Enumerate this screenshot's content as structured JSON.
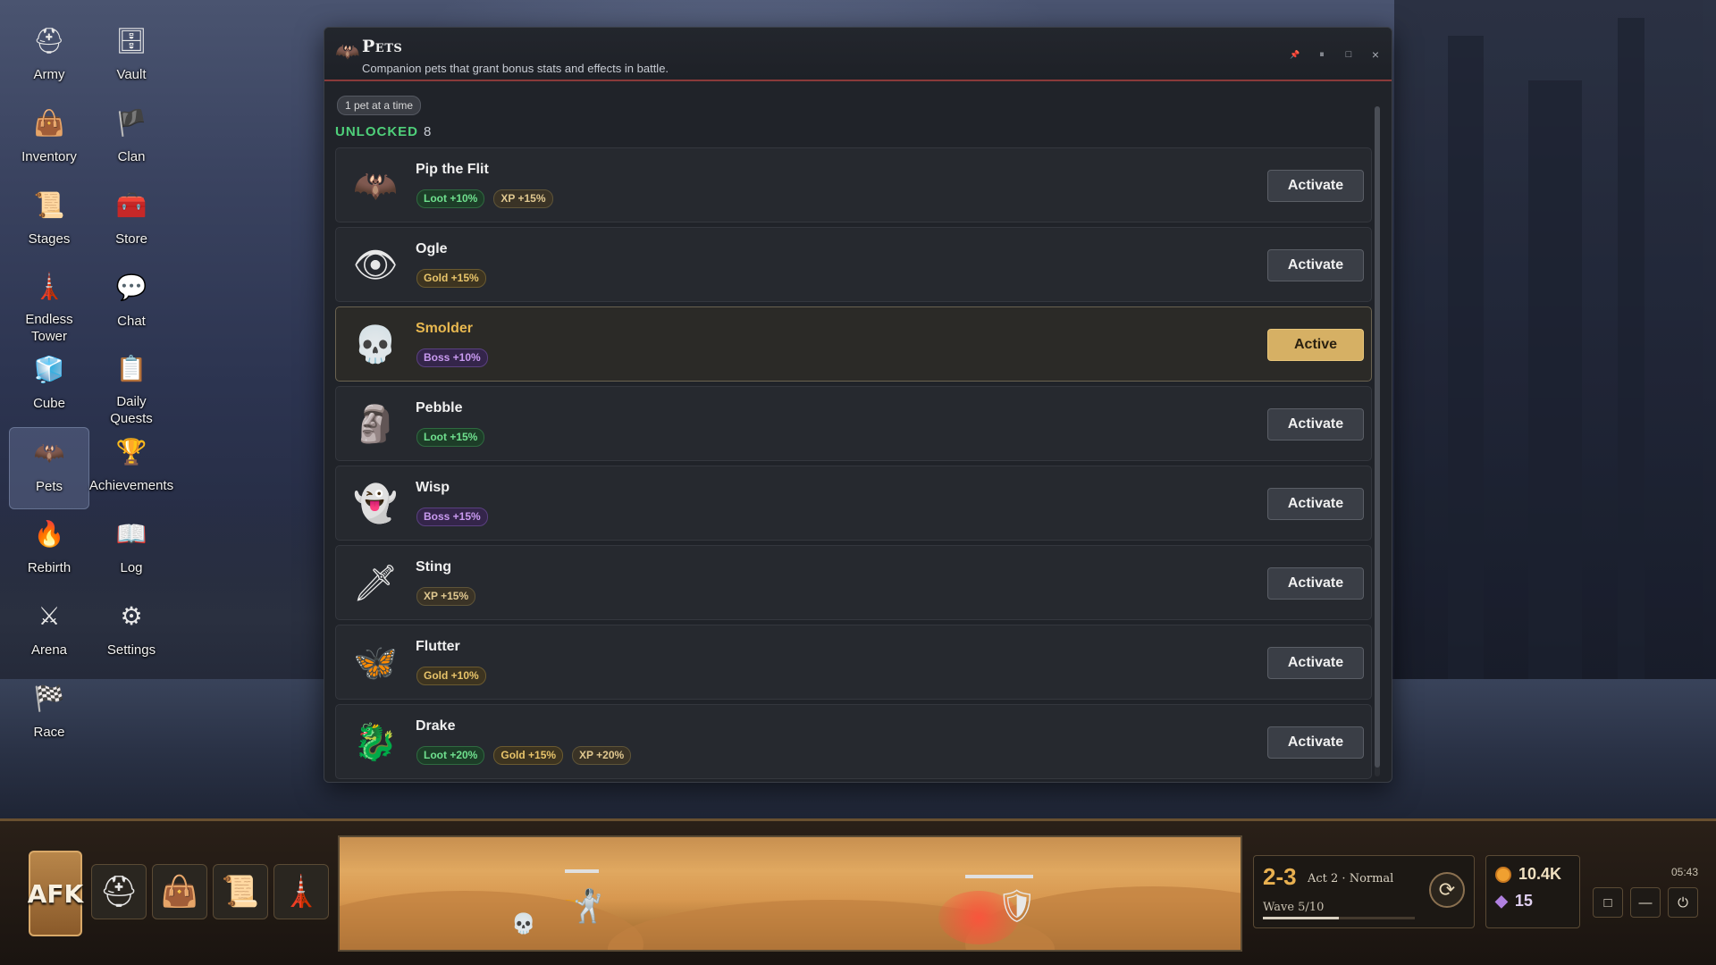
{
  "desktop": {
    "icons": [
      {
        "label": "Army",
        "icon": "knight-helmet-icon",
        "glyph": "⛑"
      },
      {
        "label": "Vault",
        "icon": "vault-chest-icon",
        "glyph": "🗄"
      },
      {
        "label": "Inventory",
        "icon": "bag-icon",
        "glyph": "👜"
      },
      {
        "label": "Clan",
        "icon": "clan-banner-icon",
        "glyph": "🏴"
      },
      {
        "label": "Stages",
        "icon": "scroll-map-icon",
        "glyph": "📜"
      },
      {
        "label": "Store",
        "icon": "treasure-chest-icon",
        "glyph": "🧰"
      },
      {
        "label": "Endless Tower",
        "icon": "tower-icon",
        "glyph": "🗼"
      },
      {
        "label": "Chat",
        "icon": "chat-bubbles-icon",
        "glyph": "💬"
      },
      {
        "label": "Cube",
        "icon": "cube-icon",
        "glyph": "🧊"
      },
      {
        "label": "Daily Quests",
        "icon": "quest-scroll-icon",
        "glyph": "📋"
      },
      {
        "label": "Pets",
        "icon": "pet-bat-icon",
        "glyph": "🦇",
        "selected": true
      },
      {
        "label": "Achievements",
        "icon": "trophy-shield-icon",
        "glyph": "🏆"
      },
      {
        "label": "Rebirth",
        "icon": "phoenix-icon",
        "glyph": "🔥"
      },
      {
        "label": "Log",
        "icon": "open-book-icon",
        "glyph": "📖"
      },
      {
        "label": "Arena",
        "icon": "crossed-swords-icon",
        "glyph": "⚔"
      },
      {
        "label": "Settings",
        "icon": "gear-icon",
        "glyph": "⚙"
      },
      {
        "label": "Race",
        "icon": "checkered-flag-icon",
        "glyph": "🏁"
      }
    ]
  },
  "window": {
    "title": "Pets",
    "subtitle": "Companion pets that grant bonus stats and effects in battle.",
    "limit_pill": "1 pet at a time",
    "unlocked_label": "UNLOCKED",
    "unlocked_count": "8",
    "controls": {
      "pin": "📌",
      "split": "⏸",
      "maximize": "□",
      "close": "×"
    }
  },
  "pets": [
    {
      "name": "Pip the Flit",
      "icon": "bat-pet-icon",
      "glyph": "🦇",
      "tags": [
        {
          "text": "Loot +10%",
          "kind": "loot"
        },
        {
          "text": "XP +15%",
          "kind": "xp"
        }
      ],
      "button": "Activate",
      "active": false
    },
    {
      "name": "Ogle",
      "icon": "eyeball-pet-icon",
      "glyph": "👁",
      "tags": [
        {
          "text": "Gold +15%",
          "kind": "gold"
        }
      ],
      "button": "Activate",
      "active": false
    },
    {
      "name": "Smolder",
      "icon": "flaming-skull-pet-icon",
      "glyph": "💀",
      "tags": [
        {
          "text": "Boss +10%",
          "kind": "boss"
        }
      ],
      "button": "Active",
      "active": true
    },
    {
      "name": "Pebble",
      "icon": "rock-golem-pet-icon",
      "glyph": "🗿",
      "tags": [
        {
          "text": "Loot +15%",
          "kind": "loot"
        }
      ],
      "button": "Activate",
      "active": false
    },
    {
      "name": "Wisp",
      "icon": "ghost-pet-icon",
      "glyph": "👻",
      "tags": [
        {
          "text": "Boss +15%",
          "kind": "boss"
        }
      ],
      "button": "Activate",
      "active": false
    },
    {
      "name": "Sting",
      "icon": "sword-pet-icon",
      "glyph": "🗡",
      "tags": [
        {
          "text": "XP +15%",
          "kind": "xp"
        }
      ],
      "button": "Activate",
      "active": false
    },
    {
      "name": "Flutter",
      "icon": "butterfly-pet-icon",
      "glyph": "🦋",
      "tags": [
        {
          "text": "Gold +10%",
          "kind": "gold"
        }
      ],
      "button": "Activate",
      "active": false
    },
    {
      "name": "Drake",
      "icon": "dragon-pet-icon",
      "glyph": "🐉",
      "tags": [
        {
          "text": "Loot +20%",
          "kind": "loot"
        },
        {
          "text": "Gold +15%",
          "kind": "gold"
        },
        {
          "text": "XP +20%",
          "kind": "xp"
        }
      ],
      "button": "Activate",
      "active": false
    }
  ],
  "taskbar": {
    "afk_label": "AFK",
    "quick": [
      {
        "icon": "knight-helmet-icon",
        "glyph": "⛑"
      },
      {
        "icon": "bag-icon",
        "glyph": "👜"
      },
      {
        "icon": "scroll-map-icon",
        "glyph": "📜"
      },
      {
        "icon": "tower-icon",
        "glyph": "🗼"
      }
    ],
    "stage": "2-3",
    "act": "Act 2 · Normal",
    "wave": "Wave 5/10",
    "wave_progress": 0.5,
    "gold": "10.4K",
    "gems": "15",
    "clock": "05:43",
    "sys": {
      "window": "□",
      "minimize": "—",
      "power": "⏻"
    }
  },
  "colors": {
    "accent_gold": "#d6b064",
    "unlocked_green": "#4fd07a",
    "title_rule": "#8a3a3a"
  }
}
